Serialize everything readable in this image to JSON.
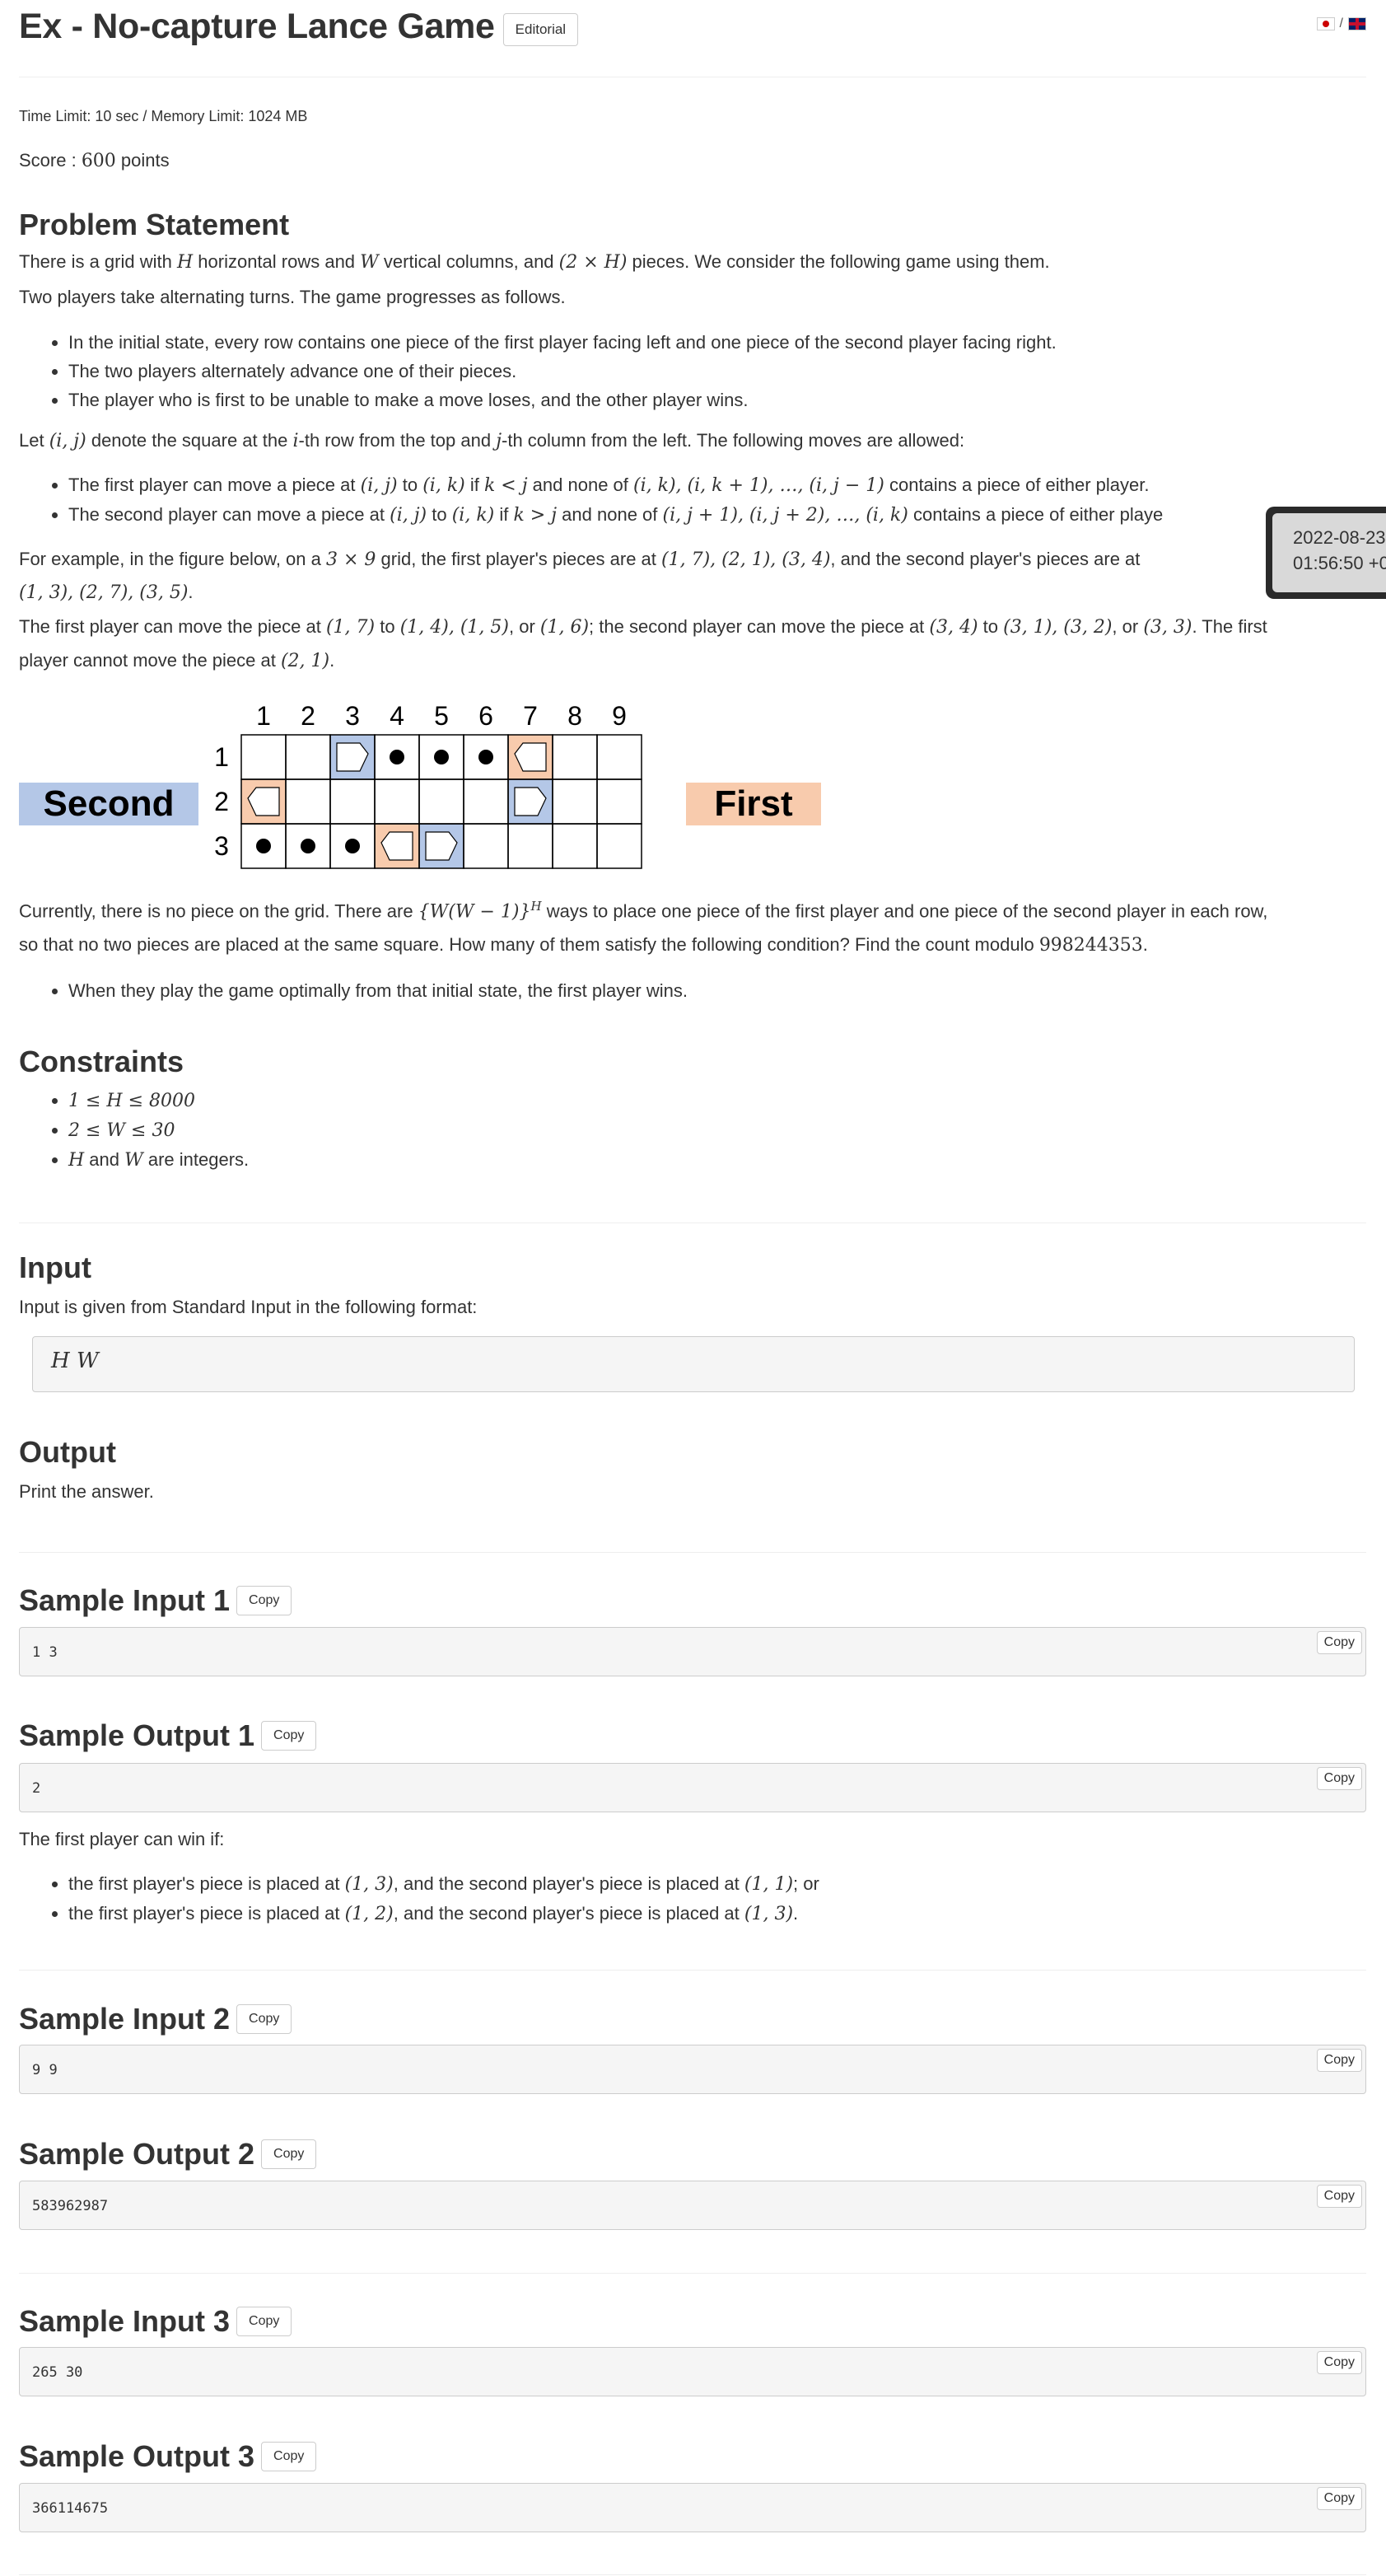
{
  "header": {
    "title": "Ex - No-capture Lance Game",
    "editorial_label": "Editorial",
    "lang_sep": "/"
  },
  "meta": {
    "limits": "Time Limit: 10 sec / Memory Limit: 1024 MB",
    "score_prefix": "Score : ",
    "score_value": "600",
    "score_suffix": " points"
  },
  "statement": {
    "heading": "Problem Statement",
    "p1_a": "There is a grid with ",
    "p1_H": "H",
    "p1_b": " horizontal rows and ",
    "p1_W": "W",
    "p1_c": " vertical columns, and ",
    "p1_expr": "(2 × H)",
    "p1_d": " pieces. We consider the following game using them.",
    "p2": "Two players take alternating turns. The game progresses as follows.",
    "rules": [
      "In the initial state, every row contains one piece of the first player facing left and one piece of the second player facing right.",
      "The two players alternately advance one of their pieces.",
      "The player who is first to be unable to make a move loses, and the other player wins."
    ],
    "p3_a": "Let ",
    "p3_ij": "(i, j)",
    "p3_b": " denote the square at the ",
    "p3_i": "i",
    "p3_c": "-th row from the top and ",
    "p3_j": "j",
    "p3_d": "-th column from the left. The following moves are allowed:",
    "move1_a": "The first player can move a piece at ",
    "move1_ij": "(i, j)",
    "move1_b": " to ",
    "move1_ik": "(i, k)",
    "move1_c": " if ",
    "move1_cond": "k < j",
    "move1_d": " and none of ",
    "move1_set": "(i, k), (i, k + 1), …, (i, j − 1)",
    "move1_e": " contains a piece of either player.",
    "move2_a": "The second player can move a piece at ",
    "move2_ij": "(i, j)",
    "move2_b": " to ",
    "move2_ik": "(i, k)",
    "move2_c": " if ",
    "move2_cond": "k > j",
    "move2_d": " and none of ",
    "move2_set": "(i, j + 1), (i, j + 2), …, (i, k)",
    "move2_e": " contains a piece of either playe",
    "ex1_a": "For example, in the figure below, on a ",
    "ex1_grid": "3 × 9",
    "ex1_b": " grid, the first player's pieces are at ",
    "ex1_first": "(1, 7), (2, 1), (3, 4)",
    "ex1_c": ", and the second player's pieces are at",
    "ex1_second": "(1, 3), (2, 7), (3, 5)",
    "ex1_d": ".",
    "ex2_a": "The first player can move the piece at ",
    "ex2_p": "(1, 7)",
    "ex2_b": " to ",
    "ex2_t1": "(1, 4), (1, 5)",
    "ex2_c": ", or ",
    "ex2_t2": "(1, 6)",
    "ex2_d": "; the second player can move the piece at ",
    "ex2_q": "(3, 4)",
    "ex2_e": " to ",
    "ex2_t3": "(3, 1), (3, 2)",
    "ex2_f": ", or ",
    "ex2_t4": "(3, 3)",
    "ex2_g": ". The first",
    "ex3_a": "player cannot move the piece at ",
    "ex3_p": "(2, 1)",
    "ex3_b": ".",
    "cur1_a": "Currently, there is no piece on the grid. There are ",
    "cur1_expr": "{W(W − 1)}",
    "cur1_exp": "H",
    "cur1_b": " ways to place one piece of the first player and one piece of the second player in each row,",
    "cur2_a": "so that no two pieces are placed at the same square. How many of them satisfy the following condition? Find the count modulo ",
    "cur2_mod": "998244353",
    "cur2_b": ".",
    "condition": "When they play the game optimally from that initial state, the first player wins."
  },
  "figure": {
    "cols": [
      "1",
      "2",
      "3",
      "4",
      "5",
      "6",
      "7",
      "8",
      "9"
    ],
    "rows": [
      "1",
      "2",
      "3"
    ],
    "second_label": "Second",
    "first_label": "First",
    "second_color": "#b4c7e7",
    "first_color": "#f8cbad",
    "pieces": [
      {
        "row": 1,
        "col": 3,
        "owner": "second"
      },
      {
        "row": 1,
        "col": 7,
        "owner": "first"
      },
      {
        "row": 2,
        "col": 1,
        "owner": "first"
      },
      {
        "row": 2,
        "col": 7,
        "owner": "second"
      },
      {
        "row": 3,
        "col": 4,
        "owner": "first"
      },
      {
        "row": 3,
        "col": 5,
        "owner": "second"
      }
    ],
    "dots": [
      {
        "row": 1,
        "col": 4
      },
      {
        "row": 1,
        "col": 5
      },
      {
        "row": 1,
        "col": 6
      },
      {
        "row": 3,
        "col": 1
      },
      {
        "row": 3,
        "col": 2
      },
      {
        "row": 3,
        "col": 3
      }
    ]
  },
  "constraints": {
    "heading": "Constraints",
    "c1": "1 ≤ H ≤ 8000",
    "c2": "2 ≤ W ≤ 30",
    "c3_H": "H",
    "c3_a": " and ",
    "c3_W": "W",
    "c3_b": " are integers."
  },
  "input": {
    "heading": "Input",
    "desc": "Input is given from Standard Input in the following format:",
    "format": "H   W"
  },
  "output": {
    "heading": "Output",
    "desc": "Print the answer."
  },
  "samples": {
    "copy_label": "Copy",
    "in1_title": "Sample Input 1",
    "in1": "1 3",
    "out1_title": "Sample Output 1",
    "out1": "2",
    "explain": "The first player can win if:",
    "exp1_a": "the first player's piece is placed at ",
    "exp1_p": "(1, 3)",
    "exp1_b": ", and the second player's piece is placed at ",
    "exp1_q": "(1, 1)",
    "exp1_c": "; or",
    "exp2_a": "the first player's piece is placed at ",
    "exp2_p": "(1, 2)",
    "exp2_b": ", and the second player's piece is placed at ",
    "exp2_q": "(1, 3)",
    "exp2_c": ".",
    "in2_title": "Sample Input 2",
    "in2": "9 9",
    "out2_title": "Sample Output 2",
    "out2": "583962987",
    "in3_title": "Sample Input 3",
    "in3": "265 30",
    "out3_title": "Sample Output 3",
    "out3": "366114675"
  },
  "clock": {
    "date": "2022-08-23",
    "time": "01:56:50 +0"
  }
}
